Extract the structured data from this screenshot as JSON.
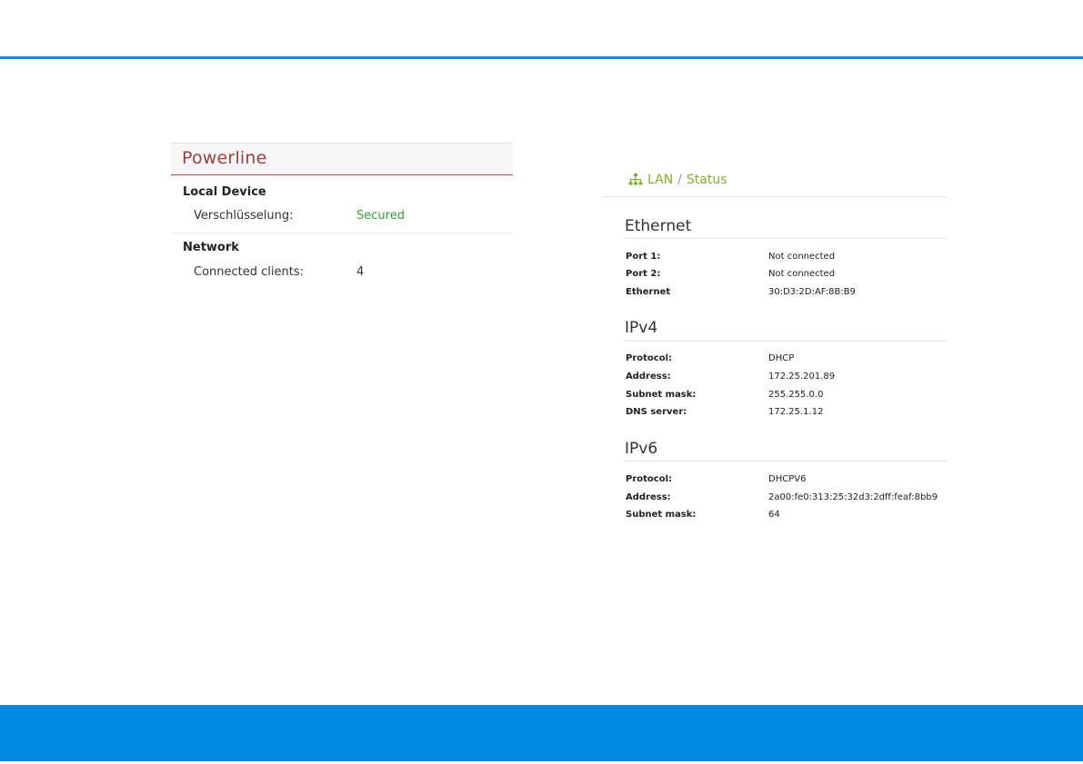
{
  "colors": {
    "accent_blue": "#0088e0",
    "powerline_title": "#9b3f3f",
    "secured_green": "#3a9a3a",
    "lan_green": "#7fb22c"
  },
  "powerline": {
    "title": "Powerline",
    "local_device": {
      "heading": "Local Device",
      "encryption_label": "Verschlüsselung:",
      "encryption_value": "Secured"
    },
    "network": {
      "heading": "Network",
      "clients_label": "Connected clients:",
      "clients_value": "4"
    }
  },
  "lan": {
    "breadcrumb": {
      "icon": "network-icon",
      "first": "LAN",
      "separator": "/",
      "second": "Status"
    },
    "ethernet": {
      "title": "Ethernet",
      "rows": [
        {
          "label": "Port 1:",
          "value": "Not connected"
        },
        {
          "label": "Port 2:",
          "value": "Not connected"
        },
        {
          "label": "Ethernet",
          "value": "30:D3:2D:AF:8B:B9"
        }
      ]
    },
    "ipv4": {
      "title": "IPv4",
      "rows": [
        {
          "label": "Protocol:",
          "value": "DHCP"
        },
        {
          "label": "Address:",
          "value": "172.25.201.89"
        },
        {
          "label": "Subnet mask:",
          "value": "255.255.0.0"
        },
        {
          "label": "DNS server:",
          "value": "172.25.1.12"
        }
      ]
    },
    "ipv6": {
      "title": "IPv6",
      "rows": [
        {
          "label": "Protocol:",
          "value": "DHCPV6"
        },
        {
          "label": "Address:",
          "value": "2a00:fe0:313:25:32d3:2dff:feaf:8bb9"
        },
        {
          "label": "Subnet mask:",
          "value": "64"
        }
      ]
    }
  }
}
